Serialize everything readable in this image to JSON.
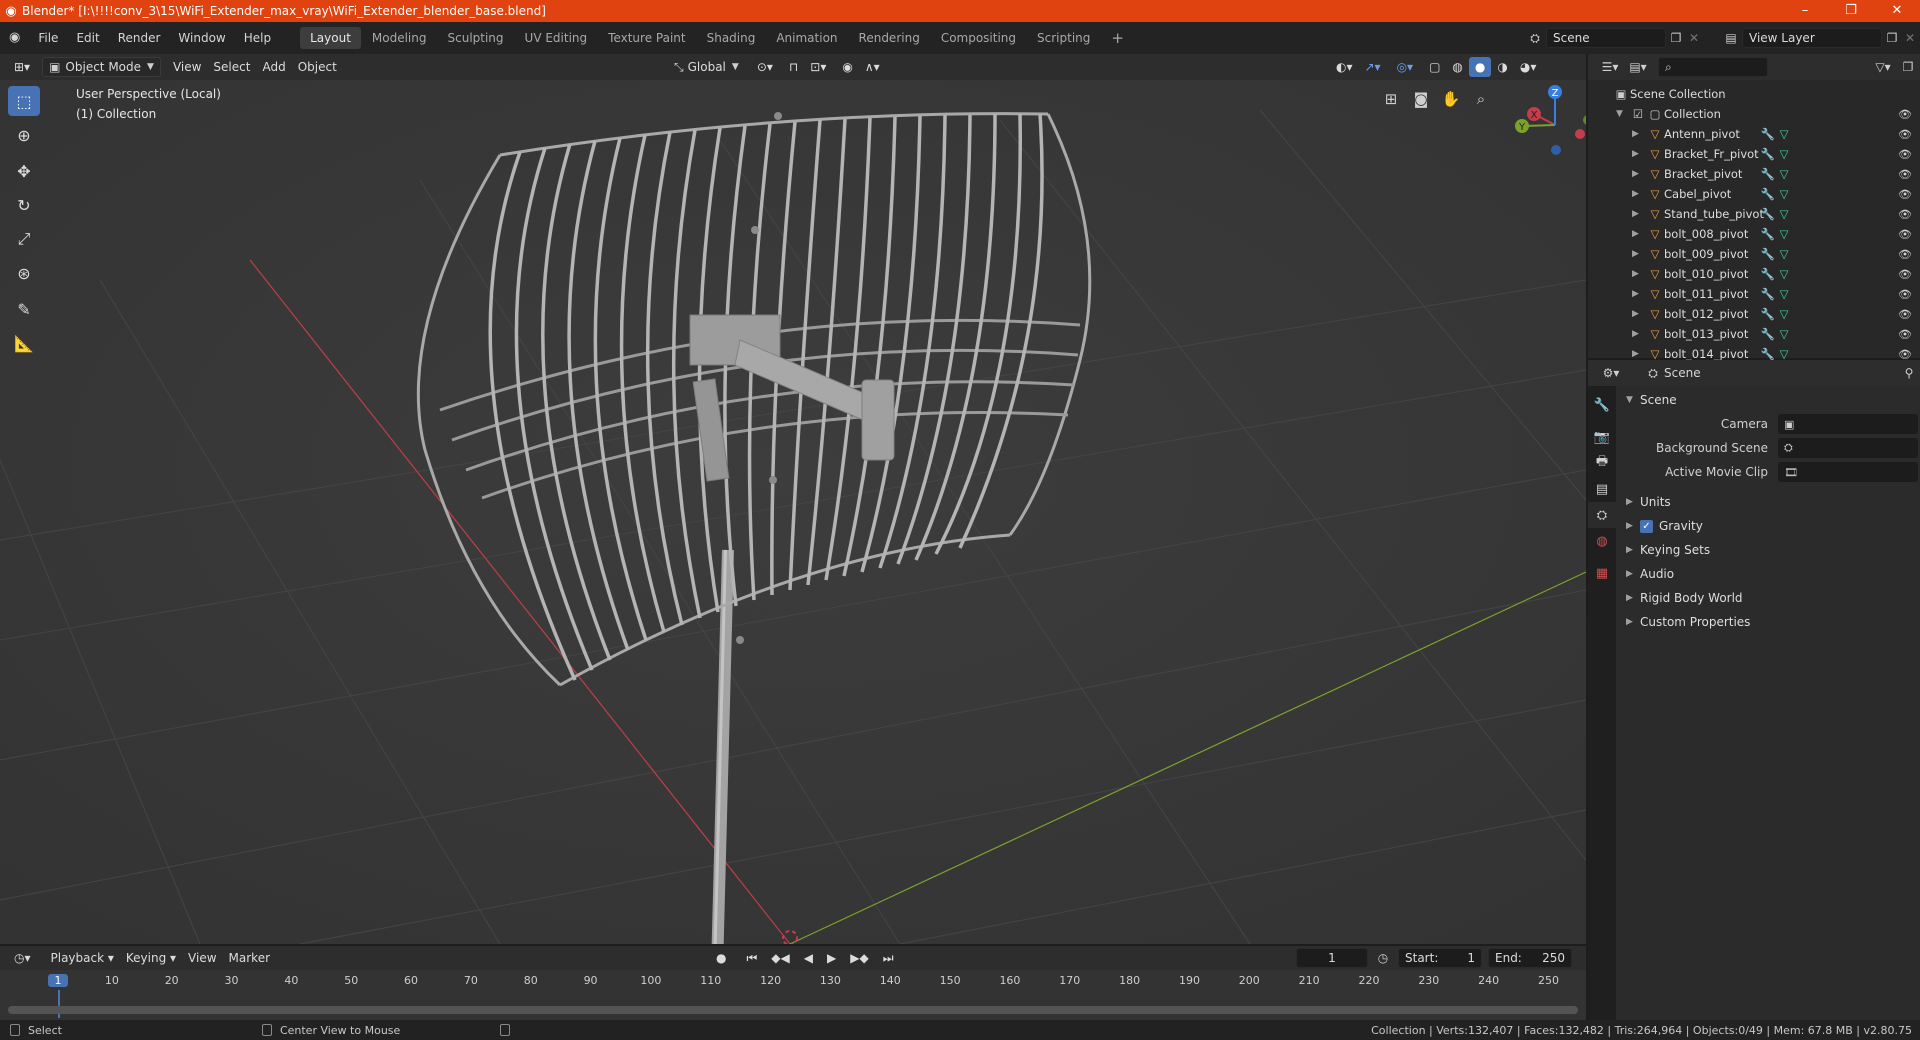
{
  "titlebar": {
    "title": "Blender* [I:\\!!!!conv_3\\15\\WiFi_Extender_max_vray\\WiFi_Extender_blender_base.blend]",
    "minimize": "–",
    "maximize": "❐",
    "close": "✕"
  },
  "menu": [
    "File",
    "Edit",
    "Render",
    "Window",
    "Help"
  ],
  "workspaces": [
    "Layout",
    "Modeling",
    "Sculpting",
    "UV Editing",
    "Texture Paint",
    "Shading",
    "Animation",
    "Rendering",
    "Compositing",
    "Scripting"
  ],
  "scene_field": "Scene",
  "view_layer_field": "View Layer",
  "viewport_header": {
    "mode": "Object Mode",
    "menus": [
      "View",
      "Select",
      "Add",
      "Object"
    ],
    "transform_orientation": "Global"
  },
  "viewport": {
    "perspective": "User Perspective (Local)",
    "collection": "(1) Collection",
    "gizmo": {
      "x": "X",
      "y": "Y",
      "z": "Z"
    }
  },
  "outliner": {
    "root": "Scene Collection",
    "collection": "Collection",
    "items": [
      "Antenn_pivot",
      "Bracket_Fr_pivot",
      "Bracket_pivot",
      "Cabel_pivot",
      "Stand_tube_pivot",
      "bolt_008_pivot",
      "bolt_009_pivot",
      "bolt_010_pivot",
      "bolt_011_pivot",
      "bolt_012_pivot",
      "bolt_013_pivot",
      "bolt_014_pivot"
    ]
  },
  "properties": {
    "context": "Scene",
    "section": "Scene",
    "fields": [
      {
        "label": "Camera"
      },
      {
        "label": "Background Scene"
      },
      {
        "label": "Active Movie Clip"
      }
    ],
    "panels": [
      "Units",
      "Gravity",
      "Keying Sets",
      "Audio",
      "Rigid Body World",
      "Custom Properties"
    ],
    "gravity_checked": true
  },
  "timeline": {
    "menus": [
      "Playback",
      "Keying",
      "View",
      "Marker"
    ],
    "current_frame": "1",
    "start_label": "Start:",
    "start": "1",
    "end_label": "End:",
    "end": "250",
    "ruler": [
      "1",
      "10",
      "20",
      "30",
      "40",
      "50",
      "60",
      "70",
      "80",
      "90",
      "100",
      "110",
      "120",
      "130",
      "140",
      "150",
      "160",
      "170",
      "180",
      "190",
      "200",
      "210",
      "220",
      "230",
      "240",
      "250"
    ]
  },
  "statusbar": {
    "left": "Select",
    "middle": "Center View to Mouse",
    "right": "Collection | Verts:132,407 | Faces:132,482 | Tris:264,964 | Objects:0/49 | Mem: 67.8 MB | v2.80.75"
  },
  "colors": {
    "titlebar": "#e0430f",
    "accent": "#4772b3",
    "x_axis": "#c33d4a",
    "y_axis": "#7ca22c",
    "z_axis": "#3a7de0"
  }
}
